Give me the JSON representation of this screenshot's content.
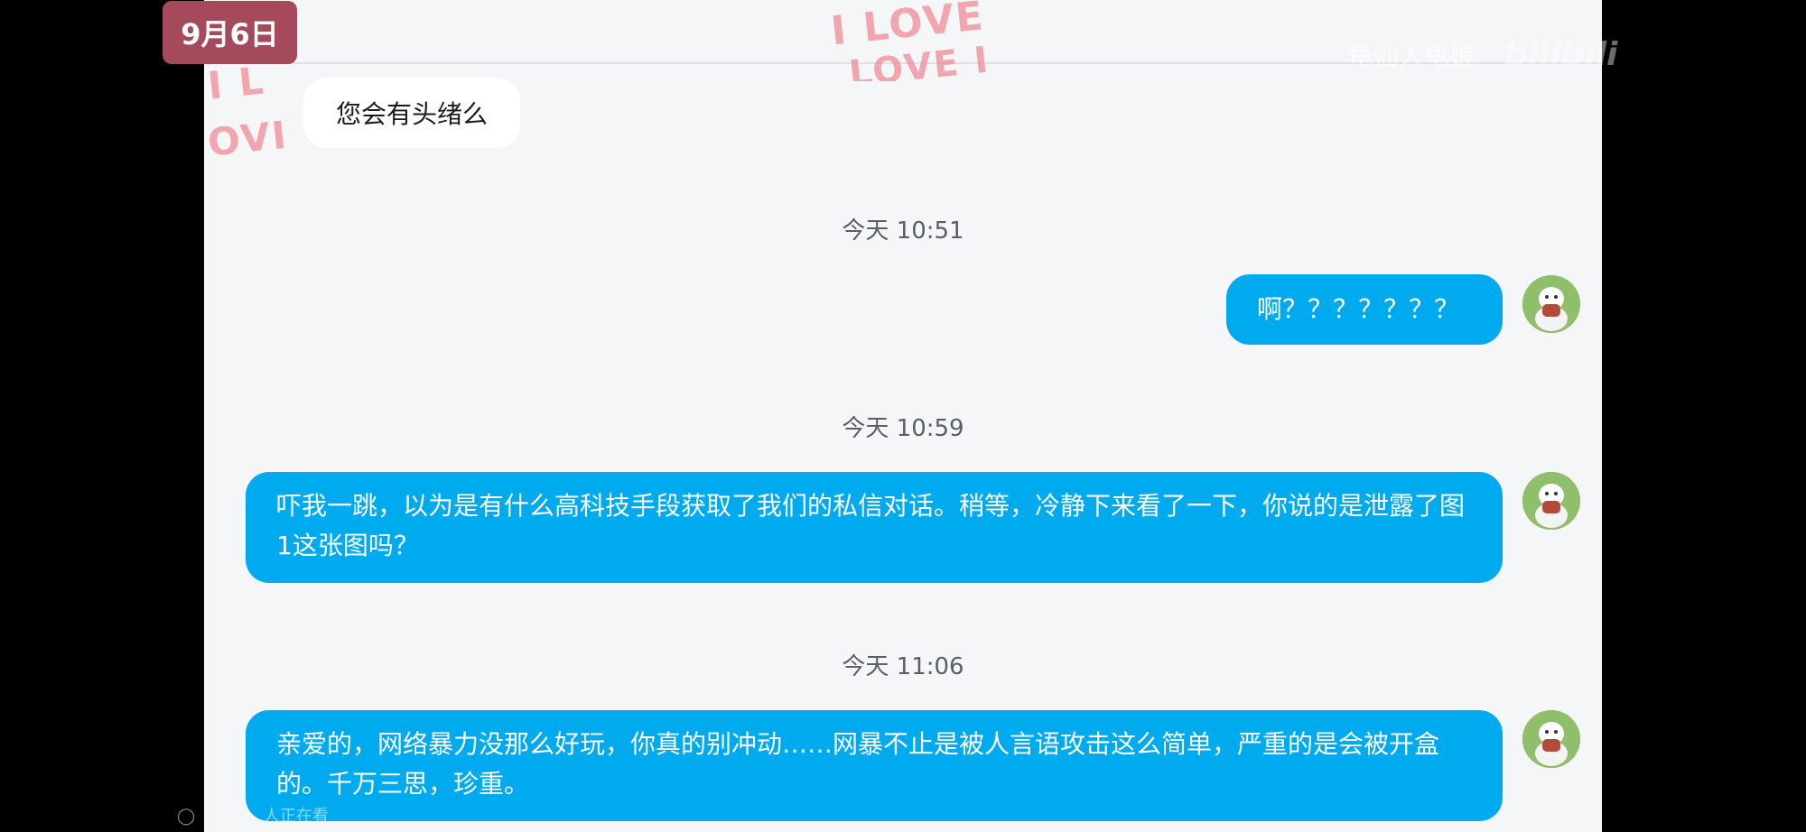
{
  "date_badge": "9月6日",
  "stickers": {
    "top": "I LOVE",
    "top_line2": "LOVE I",
    "left": "I L",
    "left_line2": "OVI"
  },
  "watermark": {
    "uploader": "龟仙人龟娘",
    "brand": "bilibili"
  },
  "messages": [
    {
      "side": "in",
      "text": "您会有头绪么"
    },
    {
      "type": "time",
      "text": "今天 10:51"
    },
    {
      "side": "out",
      "text": "啊？？？？？？？"
    },
    {
      "type": "time",
      "text": "今天 10:59"
    },
    {
      "side": "out",
      "text": "吓我一跳，以为是有什么高科技手段获取了我们的私信对话。稍等，冷静下来看了一下，你说的是泄露了图1这张图吗？"
    },
    {
      "type": "time",
      "text": "今天 11:06"
    },
    {
      "side": "out",
      "text": "亲爱的，网络暴力没那么好玩，你真的别冲动……网暴不止是被人言语攻击这么简单，严重的是会被开盒的。千万三思，珍重。"
    }
  ],
  "viewer_count": "人正在看",
  "colors": {
    "badge": "#a54a5a",
    "outgoing_bubble": "#00aaee",
    "incoming_bubble": "#ffffff",
    "panel_background": "#f5f6f8"
  },
  "icons": {
    "avatar": "user-avatar-icon",
    "viewers": "viewers-icon"
  }
}
